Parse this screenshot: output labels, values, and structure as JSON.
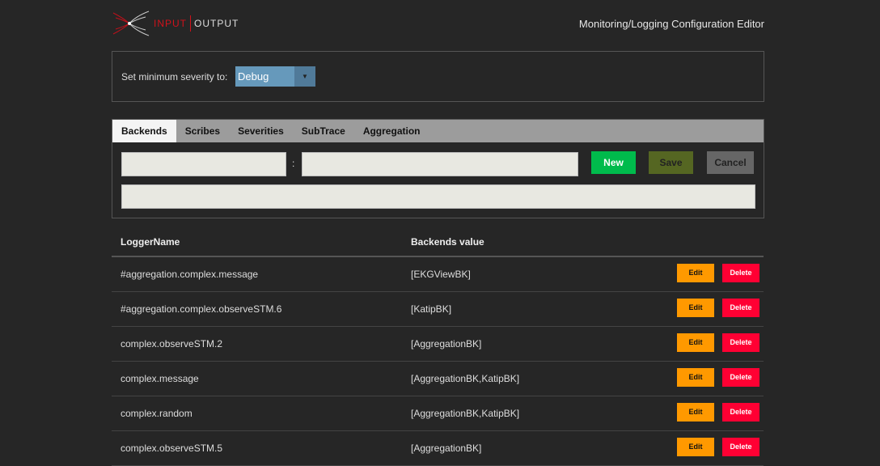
{
  "header": {
    "logo_left": "INPUT",
    "logo_right": "OUTPUT",
    "title": "Monitoring/Logging Configuration Editor"
  },
  "severity": {
    "label": "Set minimum severity to:",
    "selected": "Debug"
  },
  "tabs": [
    "Backends",
    "Scribes",
    "Severities",
    "SubTrace",
    "Aggregation"
  ],
  "form": {
    "separator": ":",
    "new": "New",
    "save": "Save",
    "cancel": "Cancel"
  },
  "colors": {
    "new": "#00bb4c",
    "save": "#556622",
    "cancel": "#666666",
    "edit": "#ff9900",
    "delete": "#ff0033"
  },
  "table": {
    "headers": [
      "LoggerName",
      "Backends value"
    ],
    "edit": "Edit",
    "delete": "Delete",
    "rows": [
      [
        "#aggregation.complex.message",
        "[EKGViewBK]"
      ],
      [
        "#aggregation.complex.observeSTM.6",
        "[KatipBK]"
      ],
      [
        "complex.observeSTM.2",
        "[AggregationBK]"
      ],
      [
        "complex.message",
        "[AggregationBK,KatipBK]"
      ],
      [
        "complex.random",
        "[AggregationBK,KatipBK]"
      ],
      [
        "complex.observeSTM.5",
        "[AggregationBK]"
      ]
    ]
  }
}
